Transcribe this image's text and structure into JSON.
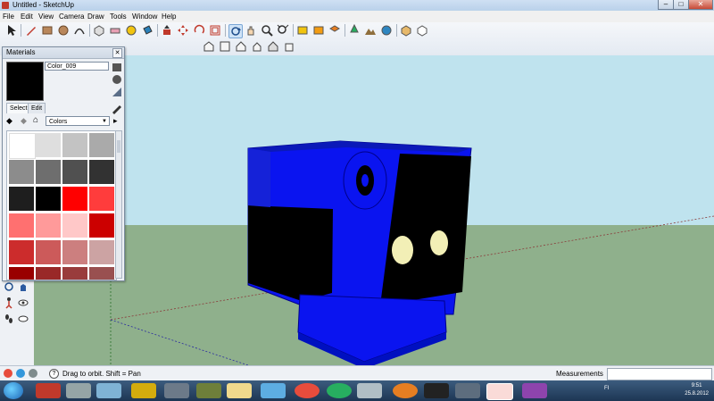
{
  "window": {
    "title": "Untitled - SketchUp"
  },
  "menu": [
    "File",
    "Edit",
    "View",
    "Camera",
    "Draw",
    "Tools",
    "Window",
    "Help"
  ],
  "materials": {
    "panel_title": "Materials",
    "current_name": "Color_009",
    "tabs": [
      "Select",
      "Edit"
    ],
    "collection": "Colors",
    "swatches": [
      "#ffffff",
      "#dedede",
      "#c3c3c3",
      "#aaaaaa",
      "#8c8c8c",
      "#6e6e6e",
      "#505050",
      "#323232",
      "#1e1e1e",
      "#000000",
      "#ff0000",
      "#ff3c3c",
      "#ff7070",
      "#ff9a9a",
      "#ffc8c8",
      "#cc0000",
      "#cc2c2c",
      "#cc5a5a",
      "#cc7f7f",
      "#cca3a3",
      "#990000",
      "#992828",
      "#993c3c",
      "#995050"
    ]
  },
  "status": {
    "message": "Drag to orbit.  Shift = Pan",
    "measurements_label": "Measurements"
  },
  "clock": {
    "time": "9:51",
    "date": "25.8.2012"
  },
  "tray": {
    "lang": "FI"
  },
  "colors": {
    "model_blue": "#0a14f0",
    "sky": "#bfe3ee",
    "ground": "#8fb08c",
    "eyes": "#f2efb6"
  }
}
